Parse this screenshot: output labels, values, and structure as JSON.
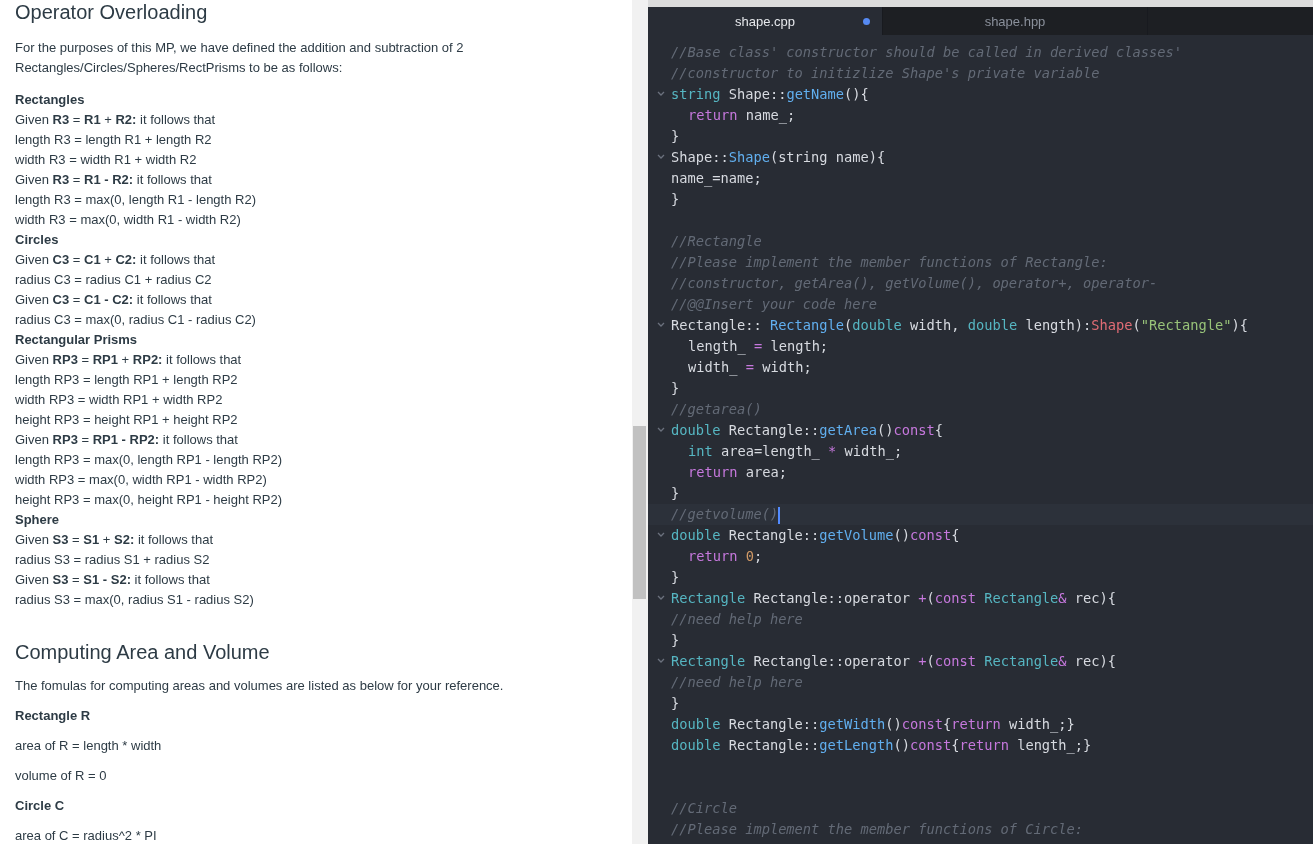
{
  "article": [
    {
      "title": "Operator Overloading",
      "intro": "For the purposes of this MP, we have defined the addition and subtraction of 2 Rectangles/Circles/Spheres/RectPrisms to be as follows:",
      "items": [
        {
          "kind": "label",
          "text": "**Rectangles**"
        },
        {
          "kind": "line",
          "text": "Given **R3** = **R1** + **R2:** it follows that"
        },
        {
          "kind": "line",
          "text": "length R3 = length R1 + length R2"
        },
        {
          "kind": "line",
          "text": "width R3 = width R1 + width R2"
        },
        {
          "kind": "line",
          "text": "Given **R3** = **R1 - R2:** it follows that"
        },
        {
          "kind": "line",
          "text": "length R3 = max(0, length R1 - length R2)"
        },
        {
          "kind": "line",
          "text": "width R3 = max(0, width R1 - width R2)"
        },
        {
          "kind": "label",
          "text": "**Circles**"
        },
        {
          "kind": "line",
          "text": "Given **C3** = **C1** + **C2:** it follows that"
        },
        {
          "kind": "line",
          "text": "radius C3 = radius C1 + radius C2"
        },
        {
          "kind": "line",
          "text": "Given **C3** = **C1 - C2:** it follows that"
        },
        {
          "kind": "line",
          "text": "radius C3 = max(0, radius C1 - radius C2)"
        },
        {
          "kind": "label",
          "text": "**Rectangular Prisms**"
        },
        {
          "kind": "line",
          "text": "Given **RP3** = **RP1** + **RP2:** it follows that"
        },
        {
          "kind": "line",
          "text": "length RP3 = length RP1 + length RP2"
        },
        {
          "kind": "line",
          "text": "width RP3 = width RP1 + width RP2"
        },
        {
          "kind": "line",
          "text": "height RP3 = height RP1 + height RP2"
        },
        {
          "kind": "line",
          "text": "Given **RP3** = **RP1 - RP2:** it follows that"
        },
        {
          "kind": "line",
          "text": "length RP3 = max(0, length RP1 - length RP2)"
        },
        {
          "kind": "line",
          "text": "width RP3 = max(0, width RP1 - width RP2)"
        },
        {
          "kind": "line",
          "text": "height RP3 = max(0, height RP1 - height RP2)"
        },
        {
          "kind": "label",
          "text": "**Sphere**"
        },
        {
          "kind": "line",
          "text": "Given **S3** = **S1** + **S2:** it follows that"
        },
        {
          "kind": "line",
          "text": "radius S3 = radius S1 + radius S2"
        },
        {
          "kind": "line",
          "text": "Given **S3** = **S1 - S2:** it follows that"
        },
        {
          "kind": "line",
          "text": "radius S3 = max(0, radius S1 - radius S2)"
        }
      ]
    },
    {
      "title": "Computing Area and Volume",
      "intro": "The fomulas for computing areas and volumes are listed as below for your reference.",
      "items": [
        {
          "kind": "para_label",
          "text": "**Rectangle R**"
        },
        {
          "kind": "para",
          "text": "area of R = length * width"
        },
        {
          "kind": "para",
          "text": "volume of R = 0"
        },
        {
          "kind": "para_label",
          "text": "**Circle C**"
        },
        {
          "kind": "para",
          "text": "area of C = radius^2 * PI"
        }
      ]
    }
  ],
  "editor": {
    "tabs": [
      {
        "label": "shape.cpp",
        "selected": true,
        "modified": true
      },
      {
        "label": "shape.hpp",
        "selected": false,
        "modified": false
      }
    ],
    "lines": [
      {
        "tokens": [
          {
            "kind": "comment",
            "text": "//Base class' constructor should be called in derived classes'"
          }
        ]
      },
      {
        "tokens": [
          {
            "kind": "comment",
            "text": "//constructor to initizlize Shape's private variable"
          }
        ]
      },
      {
        "fold": true,
        "tokens": [
          {
            "kind": "type",
            "text": "string"
          },
          {
            "kind": "plain",
            "text": " Shape::"
          },
          {
            "kind": "func",
            "text": "getName"
          },
          {
            "kind": "plain",
            "text": "(){"
          }
        ]
      },
      {
        "indented": true,
        "tokens": [
          {
            "kind": "keyword",
            "text": "return"
          },
          {
            "kind": "plain",
            "text": " name_;"
          }
        ]
      },
      {
        "tokens": [
          {
            "kind": "plain",
            "text": "}"
          }
        ]
      },
      {
        "fold": true,
        "tokens": [
          {
            "kind": "plain",
            "text": "Shape::"
          },
          {
            "kind": "func",
            "text": "Shape"
          },
          {
            "kind": "plain",
            "text": "(string name){"
          }
        ]
      },
      {
        "tokens": [
          {
            "kind": "plain",
            "text": "name_=name;"
          }
        ]
      },
      {
        "tokens": [
          {
            "kind": "plain",
            "text": "}"
          }
        ]
      },
      {
        "blank_before": true,
        "tokens": [
          {
            "kind": "comment",
            "text": "//Rectangle"
          }
        ]
      },
      {
        "tokens": [
          {
            "kind": "comment",
            "text": "//Please implement the member functions of Rectangle:"
          }
        ]
      },
      {
        "tokens": [
          {
            "kind": "comment",
            "text": "//constructor, getArea(), getVolume(), operator+, operator-"
          }
        ]
      },
      {
        "tokens": [
          {
            "kind": "comment",
            "text": "//@@Insert your code here"
          }
        ]
      },
      {
        "fold": true,
        "tokens": [
          {
            "kind": "plain",
            "text": "Rectangle:: "
          },
          {
            "kind": "func",
            "text": "Rectangle"
          },
          {
            "kind": "plain",
            "text": "("
          },
          {
            "kind": "type",
            "text": "double"
          },
          {
            "kind": "plain",
            "text": " width, "
          },
          {
            "kind": "type",
            "text": "double"
          },
          {
            "kind": "plain",
            "text": " length):"
          },
          {
            "kind": "red",
            "text": "Shape"
          },
          {
            "kind": "plain",
            "text": "("
          },
          {
            "kind": "string",
            "text": "\"Rectangle\""
          },
          {
            "kind": "plain",
            "text": "){"
          }
        ]
      },
      {
        "indented": true,
        "tokens": [
          {
            "kind": "plain",
            "text": "length_ "
          },
          {
            "kind": "keyword",
            "text": "="
          },
          {
            "kind": "plain",
            "text": " length;"
          }
        ]
      },
      {
        "indented": true,
        "tokens": [
          {
            "kind": "plain",
            "text": "width_ "
          },
          {
            "kind": "keyword",
            "text": "="
          },
          {
            "kind": "plain",
            "text": " width;"
          }
        ]
      },
      {
        "tokens": [
          {
            "kind": "plain",
            "text": "}"
          }
        ]
      },
      {
        "tokens": [
          {
            "kind": "comment",
            "text": "//getarea()"
          }
        ]
      },
      {
        "fold": true,
        "tokens": [
          {
            "kind": "type",
            "text": "double"
          },
          {
            "kind": "plain",
            "text": " Rectangle::"
          },
          {
            "kind": "func",
            "text": "getArea"
          },
          {
            "kind": "plain",
            "text": "()"
          },
          {
            "kind": "keyword",
            "text": "const"
          },
          {
            "kind": "plain",
            "text": "{"
          }
        ]
      },
      {
        "indented": true,
        "tokens": [
          {
            "kind": "type",
            "text": "int"
          },
          {
            "kind": "plain",
            "text": " area=length_ "
          },
          {
            "kind": "keyword",
            "text": "*"
          },
          {
            "kind": "plain",
            "text": " width_;"
          }
        ]
      },
      {
        "indented": true,
        "tokens": [
          {
            "kind": "keyword",
            "text": "return"
          },
          {
            "kind": "plain",
            "text": " area;"
          }
        ]
      },
      {
        "tokens": [
          {
            "kind": "plain",
            "text": "}"
          }
        ]
      },
      {
        "cursor": true,
        "tokens": [
          {
            "kind": "comment",
            "text": "//getvolume()"
          }
        ]
      },
      {
        "fold": true,
        "tokens": [
          {
            "kind": "type",
            "text": "double"
          },
          {
            "kind": "plain",
            "text": " Rectangle::"
          },
          {
            "kind": "func",
            "text": "getVolume"
          },
          {
            "kind": "plain",
            "text": "()"
          },
          {
            "kind": "keyword",
            "text": "const"
          },
          {
            "kind": "plain",
            "text": "{"
          }
        ]
      },
      {
        "indented": true,
        "tokens": [
          {
            "kind": "keyword",
            "text": "return "
          },
          {
            "kind": "number",
            "text": "0"
          },
          {
            "kind": "plain",
            "text": ";"
          }
        ]
      },
      {
        "tokens": [
          {
            "kind": "plain",
            "text": "}"
          }
        ]
      },
      {
        "fold": true,
        "tokens": [
          {
            "kind": "type",
            "text": "Rectangle"
          },
          {
            "kind": "plain",
            "text": " Rectangle::operator "
          },
          {
            "kind": "keyword",
            "text": "+"
          },
          {
            "kind": "plain",
            "text": "("
          },
          {
            "kind": "keyword",
            "text": "const "
          },
          {
            "kind": "type",
            "text": "Rectangle"
          },
          {
            "kind": "keyword",
            "text": "&"
          },
          {
            "kind": "plain",
            "text": " rec){"
          }
        ]
      },
      {
        "tokens": [
          {
            "kind": "comment",
            "text": "//need help here"
          }
        ]
      },
      {
        "tokens": [
          {
            "kind": "plain",
            "text": "}"
          }
        ]
      },
      {
        "fold": true,
        "tokens": [
          {
            "kind": "type",
            "text": "Rectangle"
          },
          {
            "kind": "plain",
            "text": " Rectangle::operator "
          },
          {
            "kind": "keyword",
            "text": "+"
          },
          {
            "kind": "plain",
            "text": "("
          },
          {
            "kind": "keyword",
            "text": "const "
          },
          {
            "kind": "type",
            "text": "Rectangle"
          },
          {
            "kind": "keyword",
            "text": "&"
          },
          {
            "kind": "plain",
            "text": " rec){"
          }
        ]
      },
      {
        "tokens": [
          {
            "kind": "comment",
            "text": "//need help here"
          }
        ]
      },
      {
        "tokens": [
          {
            "kind": "plain",
            "text": "}"
          }
        ]
      },
      {
        "tokens": [
          {
            "kind": "type",
            "text": "double"
          },
          {
            "kind": "plain",
            "text": " Rectangle::"
          },
          {
            "kind": "func",
            "text": "getWidth"
          },
          {
            "kind": "plain",
            "text": "()"
          },
          {
            "kind": "keyword",
            "text": "const"
          },
          {
            "kind": "plain",
            "text": "{"
          },
          {
            "kind": "keyword",
            "text": "return"
          },
          {
            "kind": "plain",
            "text": " width_;}"
          }
        ]
      },
      {
        "tokens": [
          {
            "kind": "type",
            "text": "double"
          },
          {
            "kind": "plain",
            "text": " Rectangle::"
          },
          {
            "kind": "func",
            "text": "getLength"
          },
          {
            "kind": "plain",
            "text": "()"
          },
          {
            "kind": "keyword",
            "text": "const"
          },
          {
            "kind": "plain",
            "text": "{"
          },
          {
            "kind": "keyword",
            "text": "return"
          },
          {
            "kind": "plain",
            "text": " length_;}"
          }
        ]
      },
      {
        "blank_before": true,
        "blank_after_previous": true,
        "tokens": [
          {
            "kind": "comment",
            "text": "//Circle"
          }
        ]
      },
      {
        "tokens": [
          {
            "kind": "comment",
            "text": "//Please implement the member functions of Circle:"
          }
        ]
      }
    ]
  }
}
